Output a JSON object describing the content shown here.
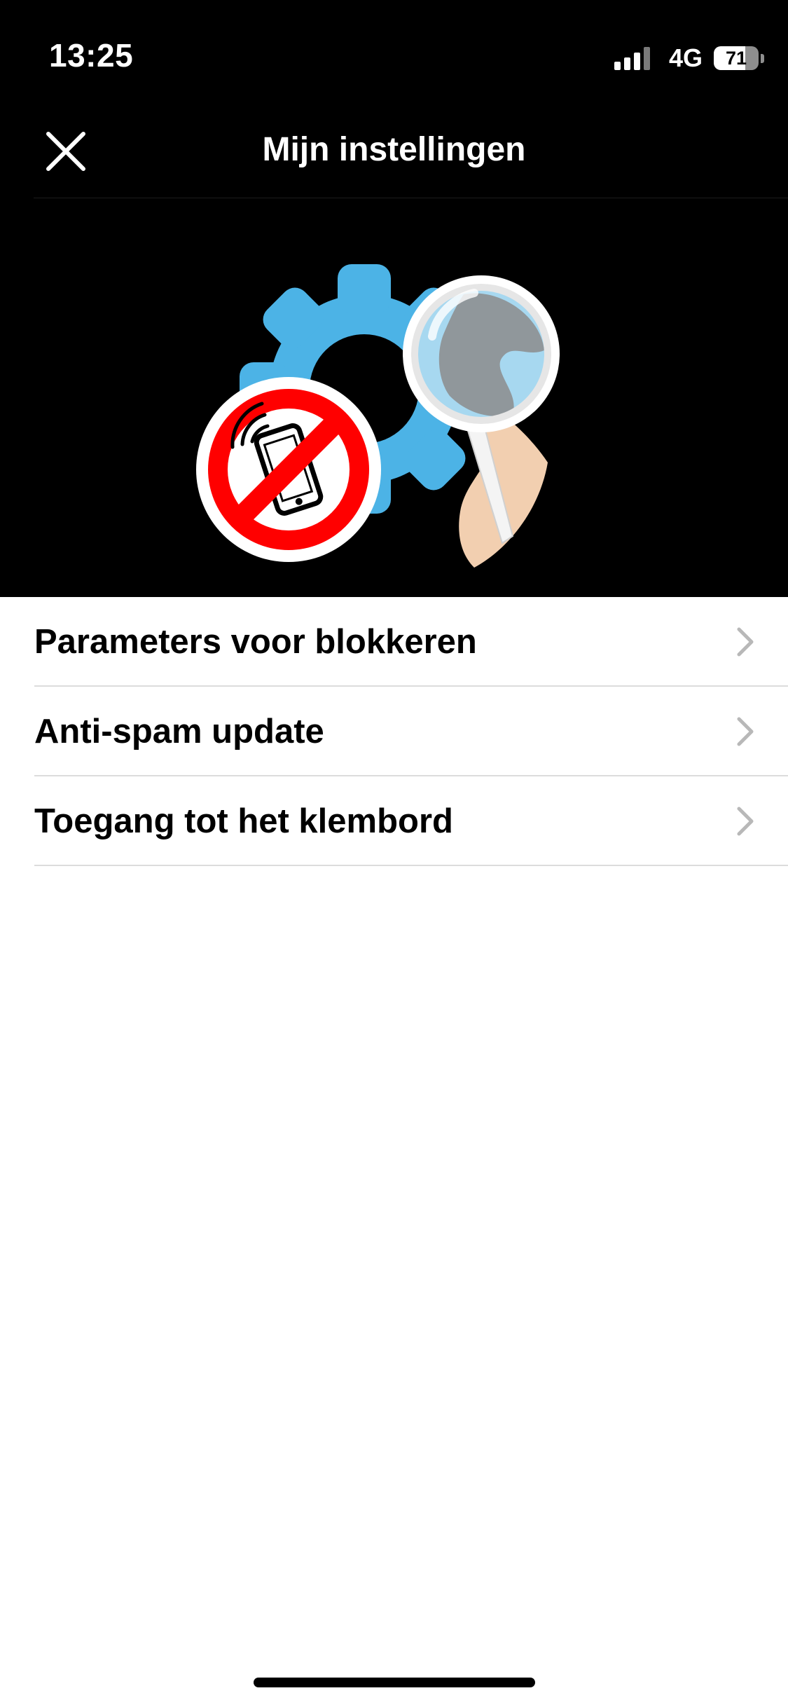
{
  "status_bar": {
    "time": "13:25",
    "network": "4G",
    "battery": "71",
    "battery_level": 0.71,
    "signal_bars": 3,
    "signal_bars_total": 4
  },
  "nav": {
    "title": "Mijn instellingen",
    "close_icon": "close-icon"
  },
  "hero": {
    "icons": [
      "gear-icon",
      "magnifier-icon",
      "no-phone-icon",
      "hand-icon"
    ],
    "colors": {
      "gear": "#4cb3e6",
      "prohibit": "#ff0000",
      "lens": "#a7d8f0",
      "skin": "#f2cfb0"
    }
  },
  "menu": {
    "items": [
      {
        "label": "Parameters voor blokkeren",
        "icon": "chevron-right-icon"
      },
      {
        "label": "Anti-spam update",
        "icon": "chevron-right-icon"
      },
      {
        "label": "Toegang tot het klembord",
        "icon": "chevron-right-icon"
      }
    ]
  },
  "colors": {
    "header_bg": "#000000",
    "content_bg": "#ffffff",
    "divider": "#dcdcdc",
    "chevron": "#b8b8b8"
  }
}
